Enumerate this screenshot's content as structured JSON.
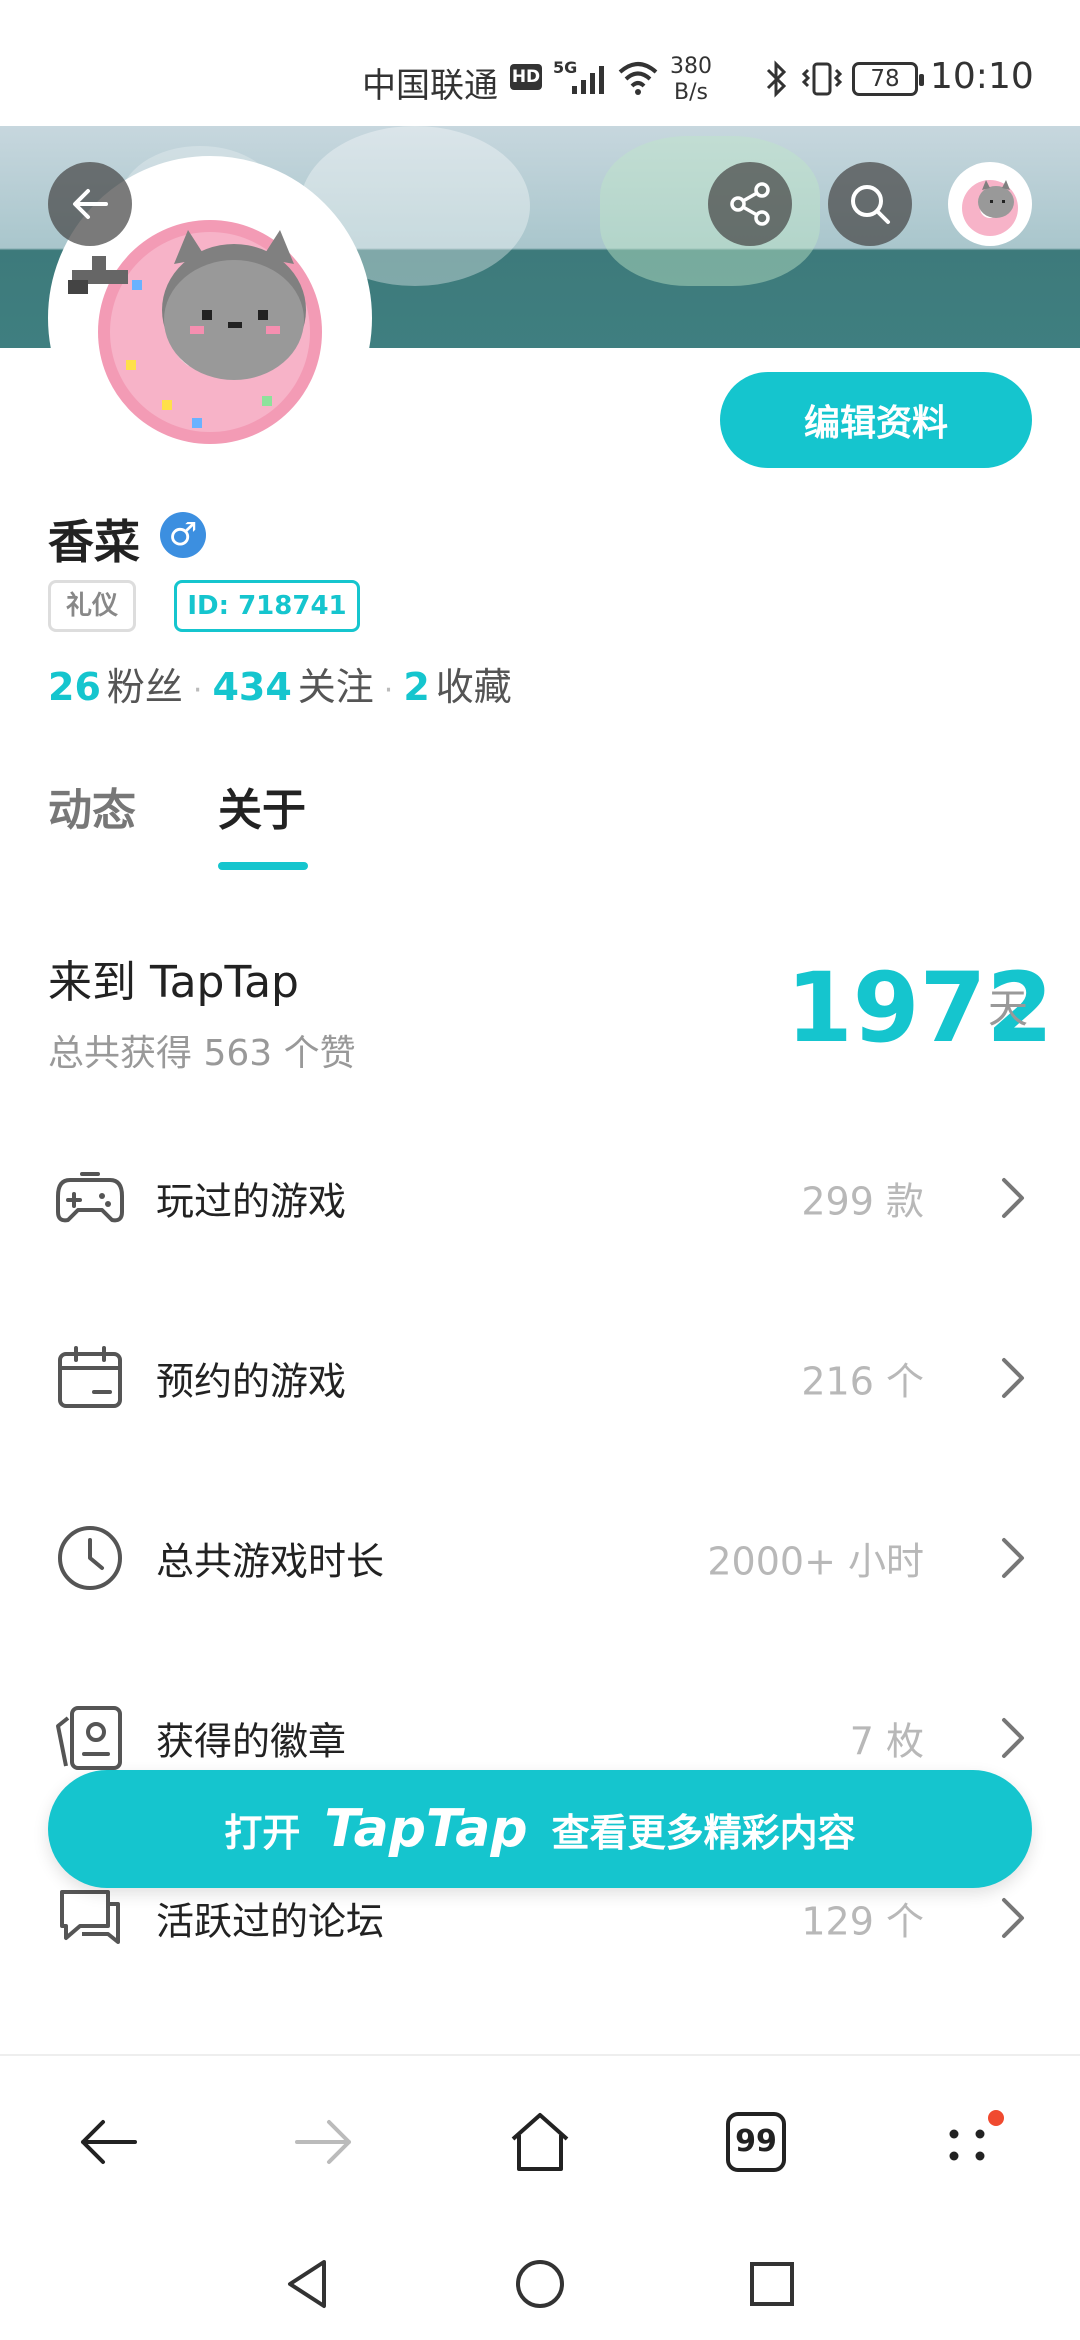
{
  "status_bar": {
    "carrier": "中国联通",
    "hd": "HD",
    "network": "5G",
    "speed_value": "380",
    "speed_unit": "B/s",
    "battery": "78",
    "time": "10:10"
  },
  "profile": {
    "name": "香菜",
    "gender_symbol": "♂",
    "tag": "礼仪",
    "id_label": "ID: 718741",
    "edit_button": "编辑资料",
    "stats": [
      {
        "value": "26",
        "label": "粉丝"
      },
      {
        "value": "434",
        "label": "关注"
      },
      {
        "value": "2",
        "label": "收藏"
      }
    ]
  },
  "tabs": [
    {
      "label": "动态"
    },
    {
      "label": "关于"
    }
  ],
  "summary": {
    "join_label": "来到 TapTap",
    "likes_label": "总共获得 563 个赞",
    "days_value": "1972",
    "days_unit": "天"
  },
  "list": [
    {
      "label": "玩过的游戏",
      "value": "299 款",
      "icon": "gamepad-icon"
    },
    {
      "label": "预约的游戏",
      "value": "216 个",
      "icon": "calendar-icon"
    },
    {
      "label": "总共游戏时长",
      "value": "2000+ 小时",
      "icon": "clock-icon"
    },
    {
      "label": "获得的徽章",
      "value": "7 枚",
      "icon": "badge-icon"
    },
    {
      "label": "活跃过的论坛",
      "value": "129 个",
      "icon": "forum-icon"
    }
  ],
  "open_app": {
    "prefix": "打开",
    "brand": "TapTap",
    "suffix": "查看更多精彩内容"
  },
  "browser": {
    "tab_count": "99"
  },
  "colors": {
    "accent": "#15c5ce",
    "gender": "#3c8fe0",
    "notification": "#f04a2f"
  }
}
